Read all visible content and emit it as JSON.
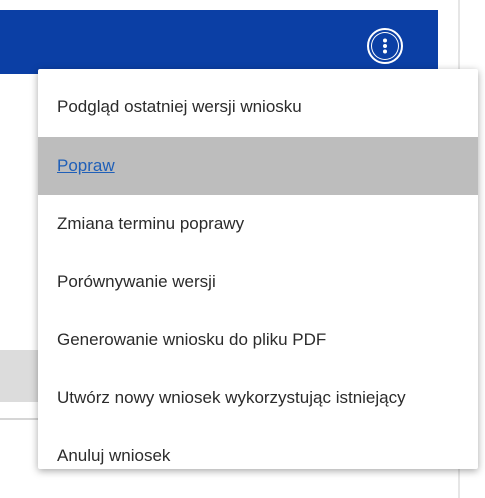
{
  "header": {
    "background": "#0b3fa5",
    "menu_button_icon": "kebab-vertical-icon"
  },
  "menu": {
    "items": [
      {
        "label": "Podgląd ostatniej wersji wniosku",
        "active": false
      },
      {
        "label": "Popraw",
        "active": true
      },
      {
        "label": "Zmiana terminu poprawy",
        "active": false
      },
      {
        "label": "Porównywanie wersji",
        "active": false
      },
      {
        "label": "Generowanie wniosku do pliku PDF",
        "active": false
      },
      {
        "label": "Utwórz nowy wniosek wykorzystując istniejący",
        "active": false
      },
      {
        "label": "Anuluj wniosek",
        "active": false
      }
    ]
  },
  "colors": {
    "active_bg": "#bdbdbd",
    "active_text": "#1f5fb8",
    "text": "#2b2b2b"
  }
}
